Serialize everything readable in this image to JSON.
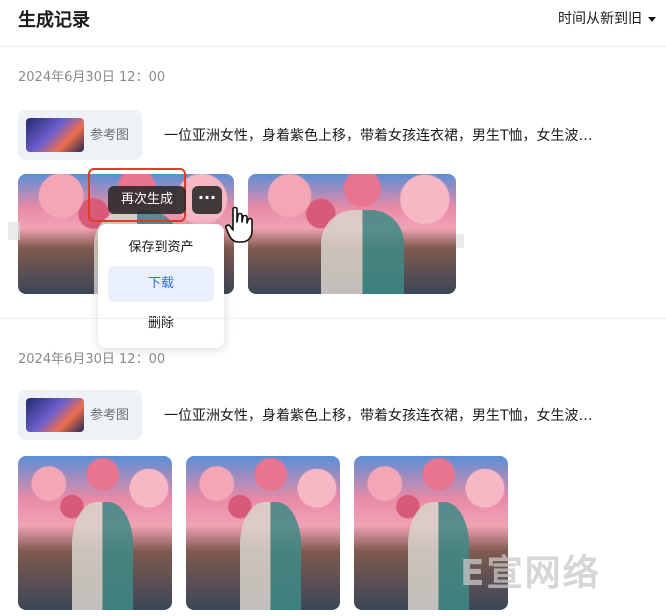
{
  "header": {
    "title": "生成记录",
    "sort_label": "时间从新到旧"
  },
  "groups": [
    {
      "date": "2024年6月30日 12：00",
      "ref_label": "参考图",
      "prompt": "一位亚洲女性，身着紫色上移，带着女孩连衣裙，男生T恤，女生波…"
    },
    {
      "date": "2024年6月30日 12：00",
      "ref_label": "参考图",
      "prompt": "一位亚洲女性，身着紫色上移，带着女孩连衣裙，男生T恤，女生波…"
    }
  ],
  "image_actions": {
    "regenerate_label": "再次生成",
    "more_label": "···"
  },
  "context_menu": {
    "items": [
      "保存到资产",
      "下载",
      "删除"
    ]
  },
  "watermark": "E宣网络"
}
